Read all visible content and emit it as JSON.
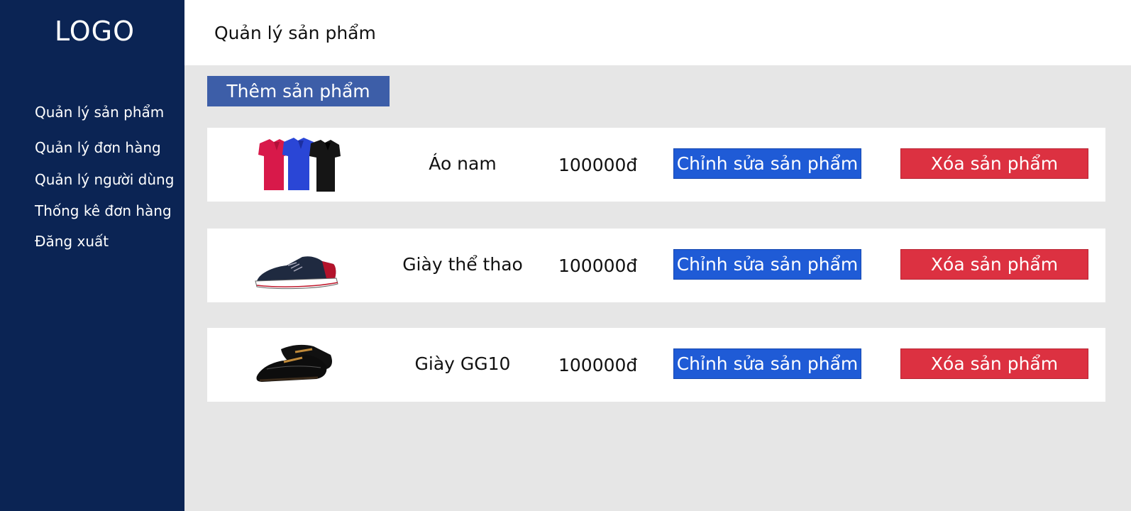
{
  "sidebar": {
    "logo": "LOGO",
    "items": [
      {
        "label": "Quản lý sản phẩm"
      },
      {
        "label": "Quản lý đơn hàng"
      },
      {
        "label": "Quản lý người dùng"
      },
      {
        "label": "Thống kê đơn hàng"
      },
      {
        "label": "Đăng xuất"
      }
    ]
  },
  "header": {
    "title": "Quản lý sản phẩm"
  },
  "toolbar": {
    "add_label": "Thêm sản phẩm"
  },
  "products": [
    {
      "name": "Áo nam",
      "price": "100000đ",
      "edit_label": "Chỉnh sửa sản phẩm",
      "delete_label": "Xóa sản phẩm",
      "image": "polo-shirts-image"
    },
    {
      "name": "Giày thể thao",
      "price": "100000đ",
      "edit_label": "Chỉnh sửa sản phẩm",
      "delete_label": "Xóa sản phẩm",
      "image": "sneaker-image"
    },
    {
      "name": "Giày GG10",
      "price": "100000đ",
      "edit_label": "Chỉnh sửa sản phẩm",
      "delete_label": "Xóa sản phẩm",
      "image": "loafer-shoes-image"
    }
  ],
  "colors": {
    "sidebar": "#0b2454",
    "add_button": "#3d5ea8",
    "edit_button": "#1f5bd6",
    "delete_button": "#dc3141",
    "content_bg": "#e6e6e6"
  }
}
